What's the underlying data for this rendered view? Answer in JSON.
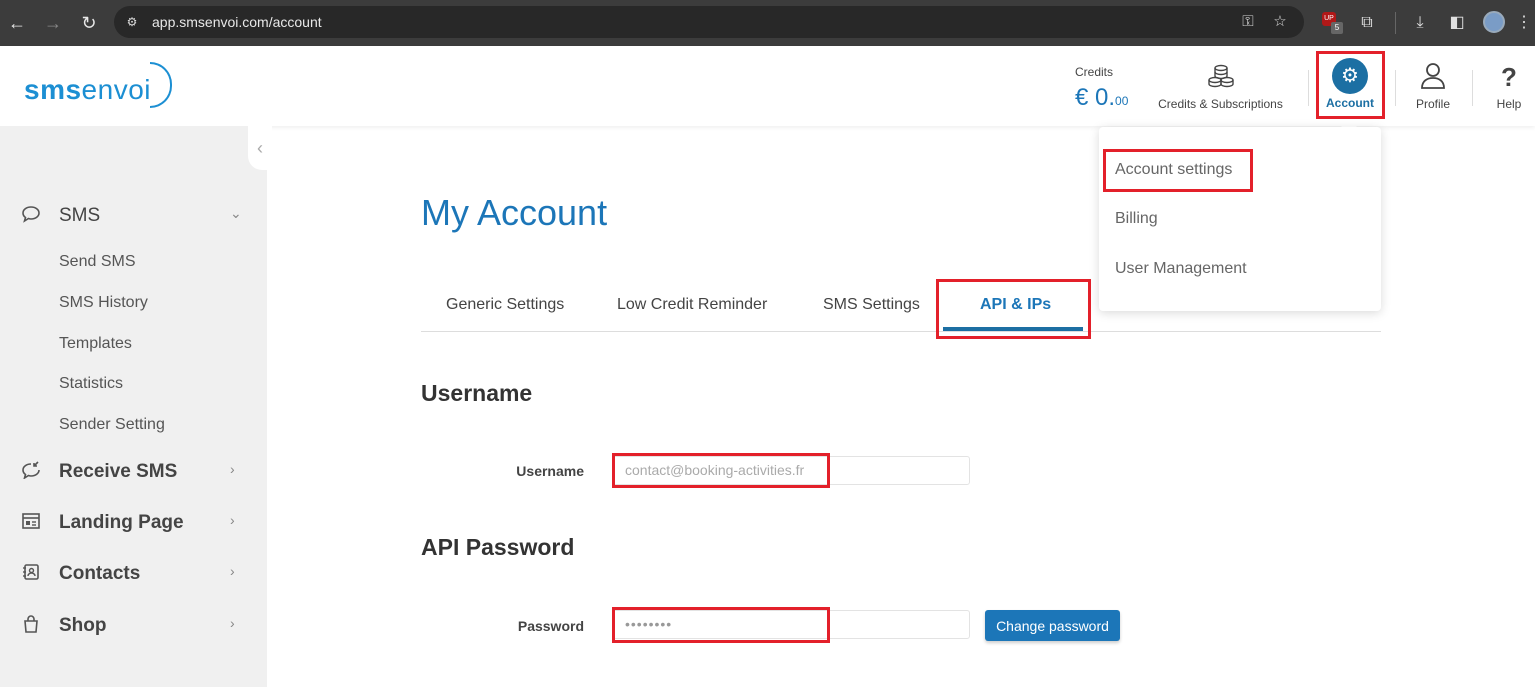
{
  "browser": {
    "url": "app.smsenvoi.com/account",
    "ext_badge_text": "UP",
    "ext_badge_count": "5"
  },
  "header": {
    "logo_sms": "sms",
    "logo_envoi": "envoi",
    "credits_label": "Credits",
    "credits_currency": "€ 0.",
    "credits_cents": "00",
    "subscriptions_label": "Credits & Subscriptions",
    "account_label": "Account",
    "profile_label": "Profile",
    "help_label": "Help"
  },
  "sidebar": {
    "sections": [
      {
        "label": "SMS",
        "icon": "speech-bubble-icon",
        "expanded": true
      },
      {
        "label": "Receive SMS",
        "icon": "receive-sms-icon",
        "expanded": false
      },
      {
        "label": "Landing Page",
        "icon": "landing-page-icon",
        "expanded": false
      },
      {
        "label": "Contacts",
        "icon": "contacts-book-icon",
        "expanded": false
      },
      {
        "label": "Shop",
        "icon": "shopping-bag-icon",
        "expanded": false
      }
    ],
    "sms_items": [
      "Send SMS",
      "SMS History",
      "Templates",
      "Statistics",
      "Sender Setting"
    ]
  },
  "main": {
    "title": "My Account",
    "tabs": [
      {
        "label": "Generic Settings",
        "active": false
      },
      {
        "label": "Low Credit Reminder",
        "active": false
      },
      {
        "label": "SMS Settings",
        "active": false
      },
      {
        "label": "API & IPs",
        "active": true
      }
    ],
    "username_section": "Username",
    "username_label": "Username",
    "username_value": "contact@booking-activities.fr",
    "password_section": "API Password",
    "password_label": "Password",
    "password_value": "••••••••",
    "change_password_button": "Change password"
  },
  "dropdown": {
    "items": [
      "Account settings",
      "Billing",
      "User Management"
    ]
  },
  "colors": {
    "brand_blue": "#1c76b8",
    "highlight_red": "#e3202a",
    "sidebar_bg": "#f0f0f0"
  }
}
